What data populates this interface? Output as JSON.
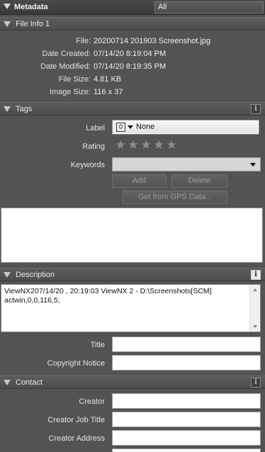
{
  "header": {
    "title": "Metadata",
    "filter_value": "All"
  },
  "file_info": {
    "section_label": "File Info 1",
    "rows": [
      {
        "label": "File:",
        "value": "20200714 201903 Screenshot.jpg"
      },
      {
        "label": "Date Created:",
        "value": "07/14/20 8:19:04 PM"
      },
      {
        "label": "Date Modified:",
        "value": "07/14/20 8:19:35 PM"
      },
      {
        "label": "File Size:",
        "value": "4.81 KB"
      },
      {
        "label": "Image Size:",
        "value": "116 x 37"
      }
    ]
  },
  "tags": {
    "section_label": "Tags",
    "label_label": "Label",
    "label_swatch": "0",
    "label_value": "None",
    "rating_label": "Rating",
    "rating_value": 0,
    "rating_max": 5,
    "keywords_label": "Keywords",
    "keywords_value": "",
    "add_button": "Add",
    "delete_button": "Delete",
    "gps_button": "Get from GPS Data..."
  },
  "description": {
    "section_label": "Description",
    "text": "ViewNX207/14/20 , 20:19:03 ViewNX 2 - D:\\Screenshots[SCM]\nactwin,0,0,116,5;",
    "title_label": "Title",
    "title_value": "",
    "copyright_label": "Copyright Notice",
    "copyright_value": ""
  },
  "contact": {
    "section_label": "Contact",
    "creator_label": "Creator",
    "creator_job_title_label": "Creator Job Title",
    "creator_address_label": "Creator Address"
  },
  "icons": {
    "collapse": "triangle-down-icon",
    "info": "info-icon",
    "star": "star-icon",
    "dropdown": "chevron-down-icon"
  },
  "colors": {
    "panel_bg": "#535353",
    "header_bg": "#4d4d4d",
    "star_empty": "#8c8c8c"
  }
}
